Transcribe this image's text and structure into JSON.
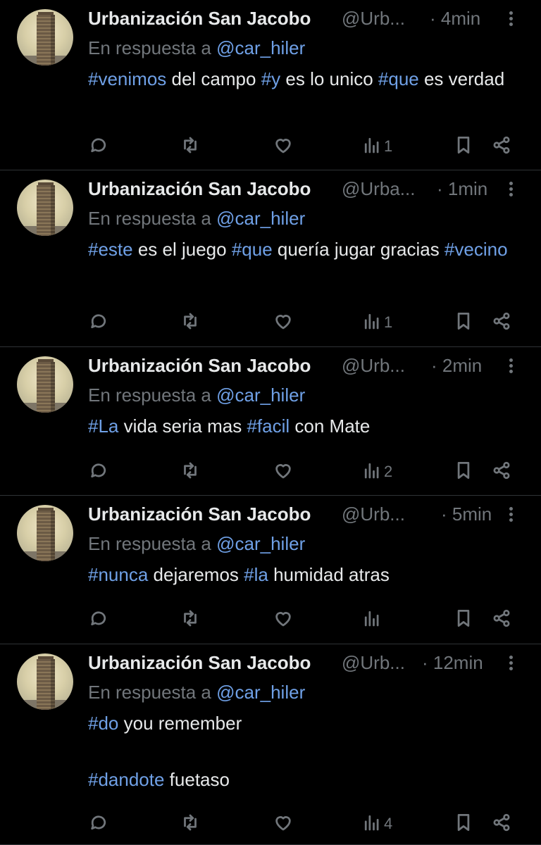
{
  "replies": [
    {
      "name": "Urbanización San Jacobo",
      "handle": "@Urb...",
      "time": "· 4min",
      "reply_prefix": "En respuesta a",
      "reply_to": "@car_hiler",
      "segments": [
        {
          "t": "#venimos",
          "tag": true
        },
        {
          "t": " del campo ",
          "tag": false
        },
        {
          "t": "#y",
          "tag": true
        },
        {
          "t": " es lo unico ",
          "tag": false
        },
        {
          "t": "#que",
          "tag": true
        },
        {
          "t": " es verdad",
          "tag": false
        }
      ],
      "views": "1"
    },
    {
      "name": "Urbanización San Jacobo",
      "handle": "@Urba...",
      "time": "· 1min",
      "reply_prefix": "En respuesta a",
      "reply_to": "@car_hiler",
      "segments": [
        {
          "t": "#este",
          "tag": true
        },
        {
          "t": " es el juego ",
          "tag": false
        },
        {
          "t": "#que",
          "tag": true
        },
        {
          "t": " quería jugar gracias ",
          "tag": false
        },
        {
          "t": "#vecino",
          "tag": true
        }
      ],
      "views": "1"
    },
    {
      "name": "Urbanización San Jacobo",
      "handle": "@Urb...",
      "time": "· 2min",
      "reply_prefix": "En respuesta a",
      "reply_to": "@car_hiler",
      "segments": [
        {
          "t": "#La",
          "tag": true
        },
        {
          "t": " vida seria mas ",
          "tag": false
        },
        {
          "t": "#facil",
          "tag": true
        },
        {
          "t": " con Mate",
          "tag": false
        }
      ],
      "views": "2"
    },
    {
      "name": "Urbanización San Jacobo",
      "handle": "@Urb...",
      "time": "· 5min",
      "reply_prefix": "En respuesta a",
      "reply_to": "@car_hiler",
      "segments": [
        {
          "t": "#nunca",
          "tag": true
        },
        {
          "t": " dejaremos ",
          "tag": false
        },
        {
          "t": "#la",
          "tag": true
        },
        {
          "t": " humidad atras",
          "tag": false
        }
      ],
      "views": ""
    },
    {
      "name": "Urbanización San Jacobo",
      "handle": "@Urb...",
      "time": "· 12min",
      "reply_prefix": "En respuesta a",
      "reply_to": "@car_hiler",
      "segments": [
        {
          "t": "#do",
          "tag": true
        },
        {
          "t": " you remember\n\n",
          "tag": false
        },
        {
          "t": "#dandote",
          "tag": true
        },
        {
          "t": " fuetaso",
          "tag": false
        }
      ],
      "views": "4"
    }
  ],
  "colors": {
    "background": "#000000",
    "text": "#e7e9ea",
    "secondary": "#71767b",
    "link": "#6fa0e6",
    "divider": "#2f3336"
  },
  "icons": [
    "reply-icon",
    "retweet-icon",
    "like-icon",
    "views-icon",
    "bookmark-icon",
    "share-icon",
    "more-icon"
  ]
}
